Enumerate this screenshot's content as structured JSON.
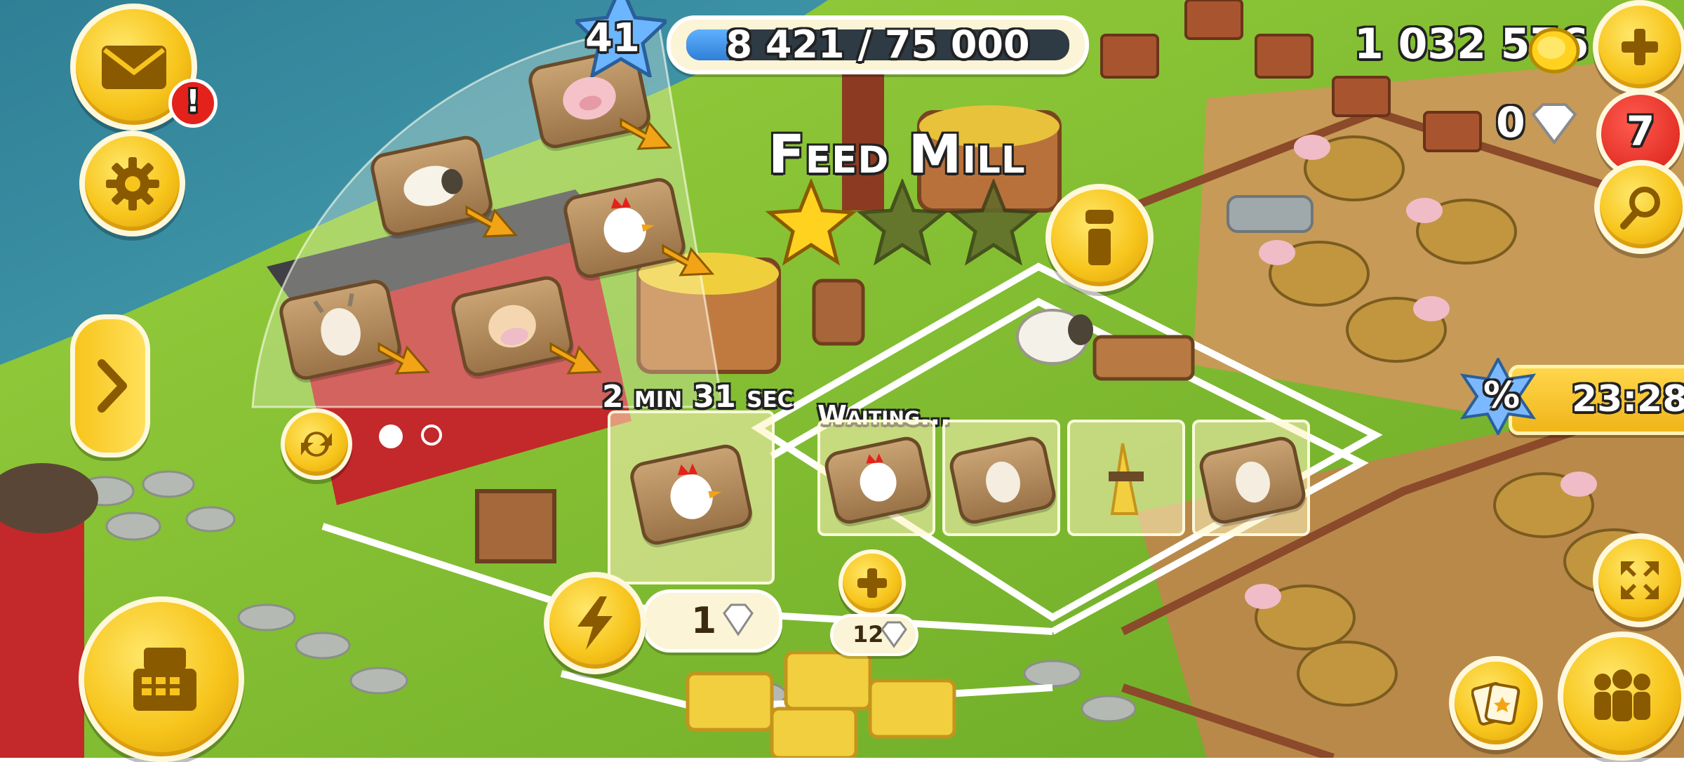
{
  "player": {
    "level": "41",
    "xp_text": "8 421 / 75 000",
    "xp_progress": 0.1123
  },
  "currency": {
    "coins": "1 032 576",
    "diamonds": "0"
  },
  "notifications": {
    "mail_badge": "!",
    "news_count": "7"
  },
  "building": {
    "title": "Feed Mill",
    "stars_earned": 1,
    "stars_total": 3,
    "timer": "2 min 31 sec",
    "queue_label": "Waiting...",
    "speed_up_cost": "1",
    "add_slot_cost": "12"
  },
  "sale": {
    "timer": "23:28",
    "badge": "%"
  },
  "recipes": [
    {
      "name": "pig-feed"
    },
    {
      "name": "sheep-feed"
    },
    {
      "name": "chicken-feed"
    },
    {
      "name": "goat-feed"
    },
    {
      "name": "cow-feed"
    }
  ],
  "queue": [
    {
      "name": "chicken-feed"
    },
    {
      "name": "goat-feed"
    },
    {
      "name": "wheat"
    },
    {
      "name": "goat-feed"
    }
  ],
  "colors": {
    "grass": "#7fbf2e",
    "water": "#3c8fa8",
    "button_gold": "#f7c51c",
    "badge_red": "#e3221b",
    "xp_bar": "#2f80d6"
  }
}
